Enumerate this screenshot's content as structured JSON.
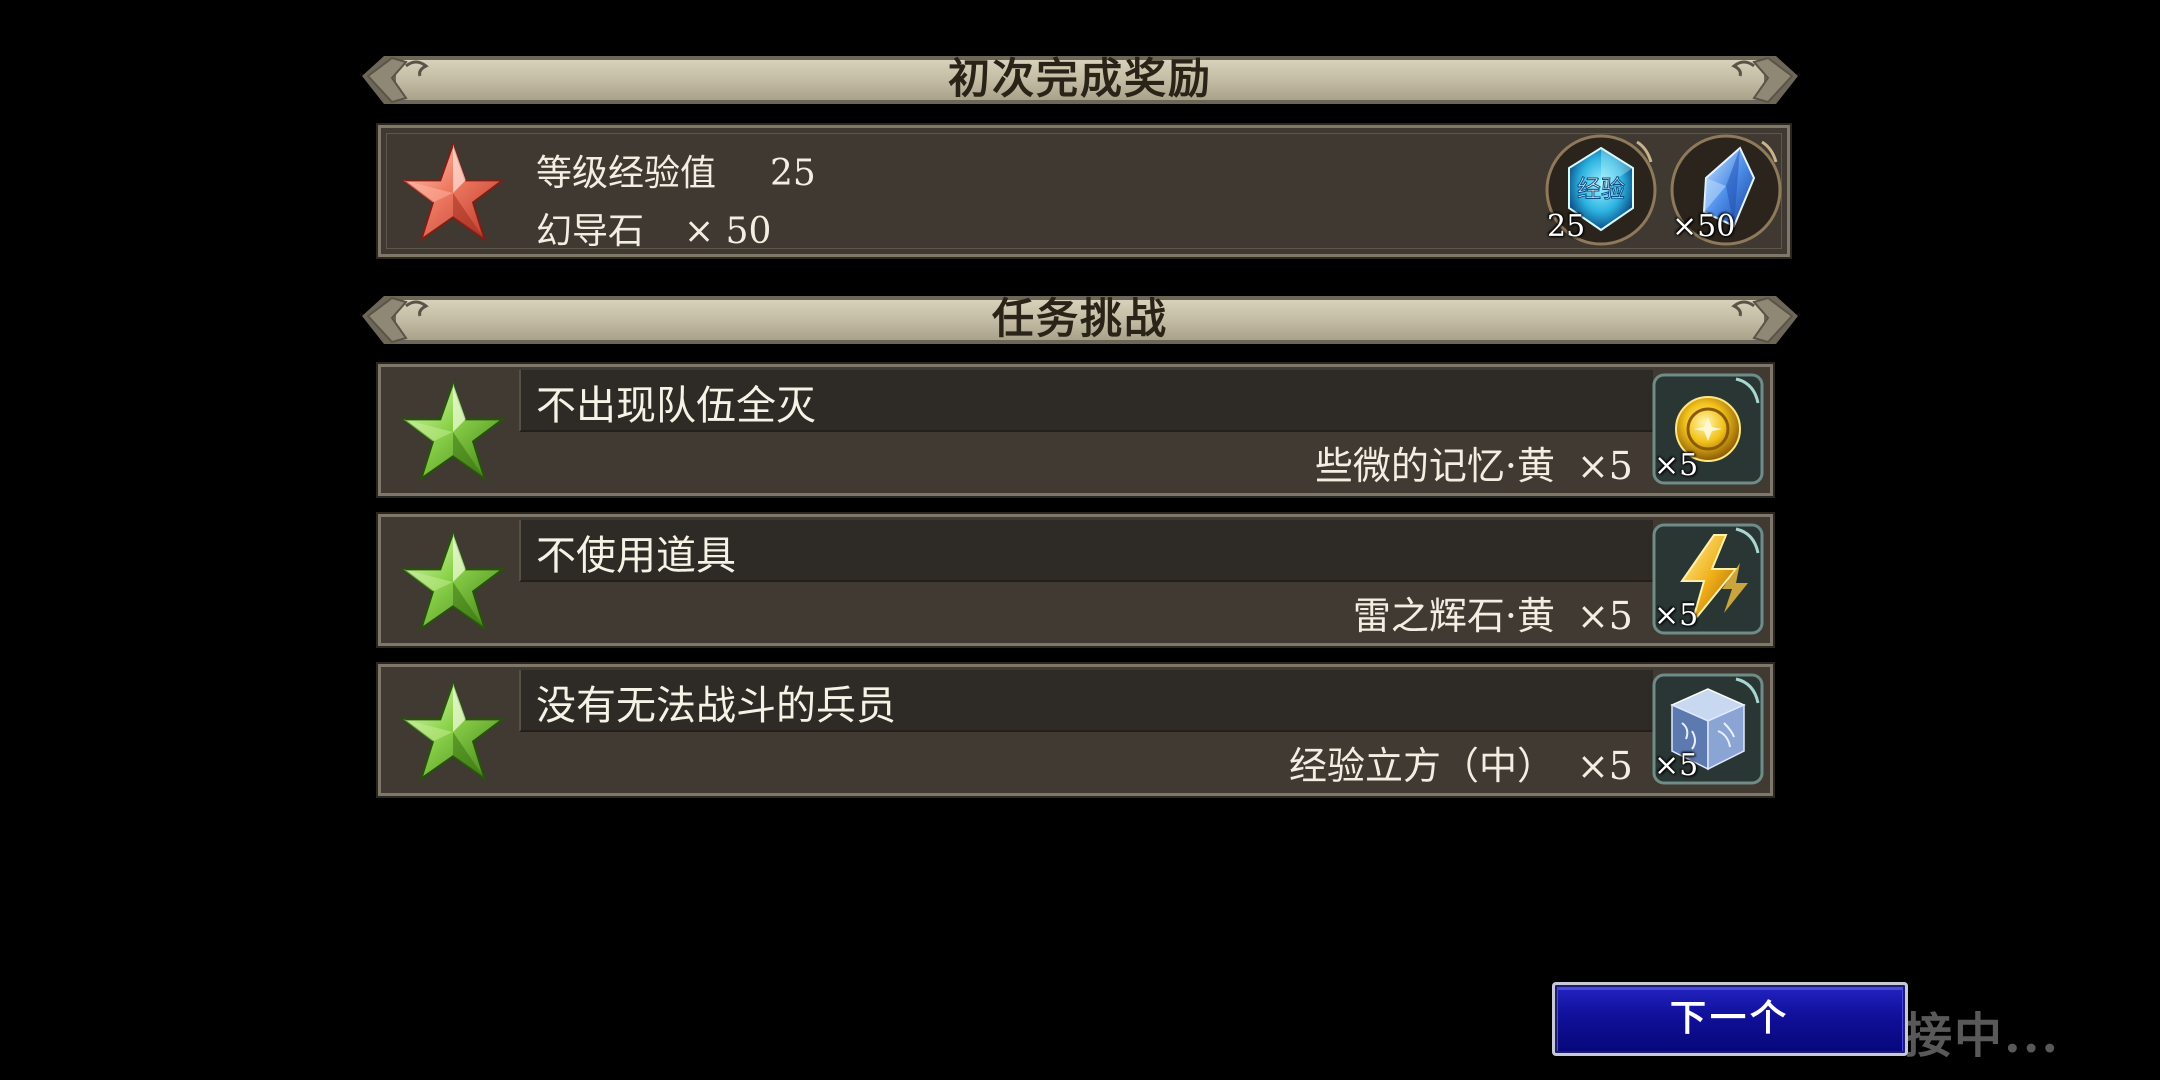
{
  "first_clear": {
    "title": "初次完成奖励",
    "lines": [
      {
        "label": "等级经验值",
        "value": "25"
      },
      {
        "label": "幻导石",
        "value": "× 50"
      }
    ],
    "icons": [
      {
        "name": "exp-crystal-icon",
        "text": "经验",
        "count": "25"
      },
      {
        "name": "blue-crystal-icon",
        "count": "×50"
      }
    ],
    "star_color": "#e8604c"
  },
  "missions": {
    "title": "任务挑战",
    "items": [
      {
        "title": "不出现队伍全灭",
        "reward": "些微的记忆·黄",
        "qty": "×5",
        "icon": "yellow-memory-orb-icon",
        "count": "×5"
      },
      {
        "title": "不使用道具",
        "reward": "雷之辉石·黄",
        "qty": "×5",
        "icon": "thunder-stone-icon",
        "count": "×5"
      },
      {
        "title": "没有无法战斗的兵员",
        "reward": "经验立方（中）",
        "qty": "×5",
        "icon": "exp-cube-icon",
        "count": "×5"
      }
    ],
    "star_color": "#7cc23a"
  },
  "next_button": {
    "label": "下一个"
  },
  "status": {
    "connecting": "接中..."
  },
  "colors": {
    "panel_bg": "#403a33",
    "ribbon": "#c8c0a8",
    "button": "#10109a"
  }
}
